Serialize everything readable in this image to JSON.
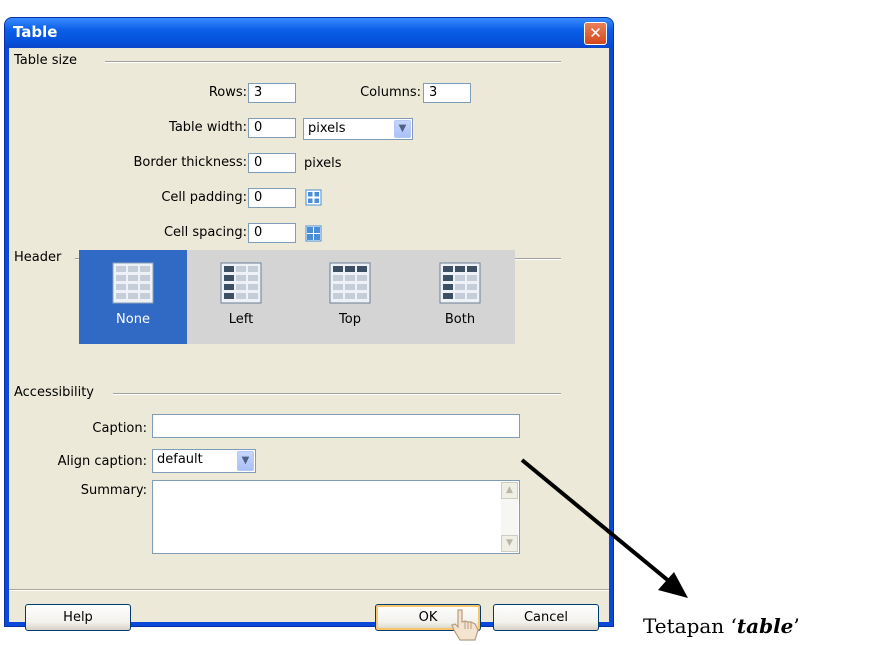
{
  "window": {
    "title": "Table"
  },
  "table_size": {
    "group_label": "Table size",
    "rows_label": "Rows:",
    "rows_value": "3",
    "columns_label": "Columns:",
    "columns_value": "3",
    "width_label": "Table width:",
    "width_value": "0",
    "width_unit": "pixels",
    "border_label": "Border thickness:",
    "border_value": "0",
    "border_unit": "pixels",
    "padding_label": "Cell padding:",
    "padding_value": "0",
    "spacing_label": "Cell spacing:",
    "spacing_value": "0"
  },
  "header": {
    "group_label": "Header",
    "options": [
      {
        "label": "None",
        "selected": true
      },
      {
        "label": "Left",
        "selected": false
      },
      {
        "label": "Top",
        "selected": false
      },
      {
        "label": "Both",
        "selected": false
      }
    ]
  },
  "accessibility": {
    "group_label": "Accessibility",
    "caption_label": "Caption:",
    "caption_value": "",
    "align_label": "Align caption:",
    "align_value": "default",
    "summary_label": "Summary:",
    "summary_value": ""
  },
  "buttons": {
    "help": "Help",
    "ok": "OK",
    "cancel": "Cancel"
  },
  "annotation": {
    "prefix": "Tetapan ‘",
    "emphasis": "table",
    "suffix": "’"
  },
  "colors": {
    "title_bar": "#0a5fe8",
    "dialog_bg": "#ece9d8",
    "header_selected": "#316ac5",
    "header_band": "#d4d4d4"
  }
}
